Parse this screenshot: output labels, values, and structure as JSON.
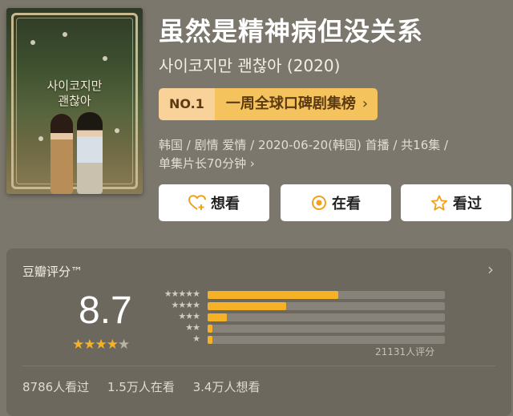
{
  "poster": {
    "title_line1": "사이코지만",
    "title_line2": "괜찮아"
  },
  "title": "虽然是精神病但没关系",
  "original_title": "사이코지만 괜찮아 (2020)",
  "ranking": {
    "number": "NO.1",
    "name": "一周全球口碑剧集榜",
    "chevron": "›"
  },
  "meta": {
    "line1": "韩国 / 剧情 爱情 / 2020-06-20(韩国) 首播 / 共16集 /",
    "line2": "单集片长70分钟",
    "chevron": "›"
  },
  "actions": [
    {
      "label": "想看",
      "icon": "heart-plus-icon"
    },
    {
      "label": "在看",
      "icon": "target-icon"
    },
    {
      "label": "看过",
      "icon": "star-outline-icon"
    }
  ],
  "rating": {
    "label": "豆瓣评分™",
    "score": "8.7",
    "stars_display": "★★★★",
    "stars_half": "★",
    "star_level": 4.5,
    "distribution": [
      {
        "stars": "★★★★★",
        "fraction": 0.55
      },
      {
        "stars": "★★★★",
        "fraction": 0.33
      },
      {
        "stars": "★★★",
        "fraction": 0.08
      },
      {
        "stars": "★★",
        "fraction": 0.02
      },
      {
        "stars": "★",
        "fraction": 0.02
      }
    ],
    "votes": "21131人评分"
  },
  "stats": {
    "watched": "8786人看过",
    "watching": "1.5万人在看",
    "wish": "3.4万人想看"
  },
  "colors": {
    "accent": "#f5b226",
    "rank_bg": "#f5c35d",
    "background": "#7b776c"
  }
}
